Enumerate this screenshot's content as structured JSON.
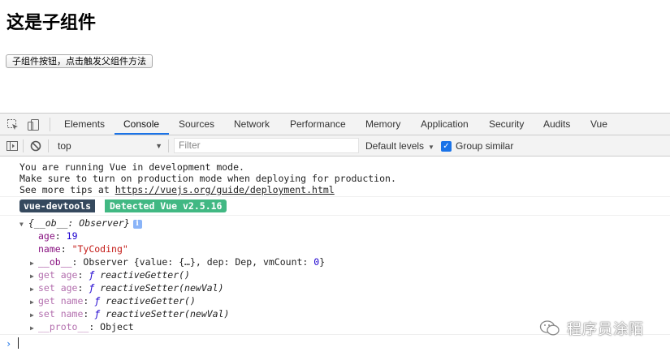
{
  "page": {
    "title": "这是子组件",
    "button_label": "子组件按钮，点击触发父组件方法"
  },
  "devtools": {
    "tabs": [
      {
        "label": "Elements"
      },
      {
        "label": "Console"
      },
      {
        "label": "Sources"
      },
      {
        "label": "Network"
      },
      {
        "label": "Performance"
      },
      {
        "label": "Memory"
      },
      {
        "label": "Application"
      },
      {
        "label": "Security"
      },
      {
        "label": "Audits"
      },
      {
        "label": "Vue"
      }
    ],
    "active_tab": "Console",
    "accent_color": "#1a73e8",
    "filterbar": {
      "context": "top",
      "filter_placeholder": "Filter",
      "levels": "Default levels",
      "group_similar": "Group similar",
      "group_similar_checked": true
    }
  },
  "console": {
    "messages": [
      "You are running Vue in development mode.",
      "Make sure to turn on production mode when deploying for production.",
      "See more tips at "
    ],
    "link": "https://vuejs.org/guide/deployment.html",
    "badge_left": "vue-devtools",
    "badge_right": "Detected Vue v2.5.16",
    "badge_colors": {
      "left": "#35495e",
      "right": "#41b883"
    },
    "object": {
      "summary": "{__ob__: Observer}",
      "info_icon": "i",
      "props": [
        {
          "key": "age",
          "sep": ": ",
          "value": "19"
        },
        {
          "key": "name",
          "sep": ": ",
          "value": "\"TyCoding\""
        },
        {
          "key": "__ob__",
          "sep": ": ",
          "value": "Observer {value: {…}, dep: Dep, vmCount: ",
          "value_num": "0",
          "value_end": "}"
        },
        {
          "key": "get age",
          "sep": ": ",
          "f": "ƒ",
          "value": "reactiveGetter()"
        },
        {
          "key": "set age",
          "sep": ": ",
          "f": "ƒ",
          "value": "reactiveSetter(newVal)"
        },
        {
          "key": "get name",
          "sep": ": ",
          "f": "ƒ",
          "value": "reactiveGetter()"
        },
        {
          "key": "set name",
          "sep": ": ",
          "f": "ƒ",
          "value": "reactiveSetter(newVal)"
        },
        {
          "key": "__proto__",
          "sep": ": ",
          "value": "Object"
        }
      ]
    },
    "prompt": "›"
  },
  "watermark": {
    "text": "程序员涂陌"
  }
}
